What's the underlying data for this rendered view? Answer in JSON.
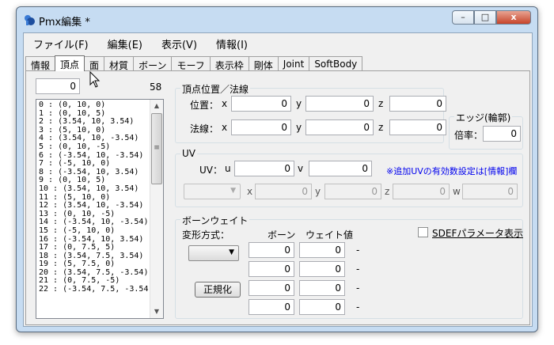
{
  "window": {
    "title": "Pmx編集 *",
    "controls": [
      "–",
      "□",
      "x"
    ]
  },
  "menu": [
    "ファイル(F)",
    "編集(E)",
    "表示(V)",
    "情報(I)"
  ],
  "tabs": [
    {
      "label": "情報",
      "active": false
    },
    {
      "label": "頂点",
      "active": true
    },
    {
      "label": "面",
      "active": false
    },
    {
      "label": "材質",
      "active": false
    },
    {
      "label": "ボーン",
      "active": false
    },
    {
      "label": "モーフ",
      "active": false
    },
    {
      "label": "表示枠",
      "active": false
    },
    {
      "label": "剛体",
      "active": false
    },
    {
      "label": "Joint",
      "active": false
    },
    {
      "label": "SoftBody",
      "active": false
    }
  ],
  "vertex_panel": {
    "index_value": "0",
    "count": "58",
    "items": [
      "0 : (0, 10, 0)",
      "1 : (0, 10, 5)",
      "2 : (3.54, 10, 3.54)",
      "3 : (5, 10, 0)",
      "4 : (3.54, 10, -3.54)",
      "5 : (0, 10, -5)",
      "6 : (-3.54, 10, -3.54)",
      "7 : (-5, 10, 0)",
      "8 : (-3.54, 10, 3.54)",
      "9 : (0, 10, 5)",
      "10 : (3.54, 10, 3.54)",
      "11 : (5, 10, 0)",
      "12 : (3.54, 10, -3.54)",
      "13 : (0, 10, -5)",
      "14 : (-3.54, 10, -3.54)",
      "15 : (-5, 10, 0)",
      "16 : (-3.54, 10, 3.54)",
      "17 : (0, 7.5, 5)",
      "18 : (3.54, 7.5, 3.54)",
      "19 : (5, 7.5, 0)",
      "20 : (3.54, 7.5, -3.54)",
      "21 : (0, 7.5, -5)",
      "22 : (-3.54, 7.5, -3.54)"
    ]
  },
  "position_group": {
    "title": "頂点位置／法線",
    "position_label": "位置：",
    "normal_label": "法線：",
    "axis_x": "x",
    "axis_y": "y",
    "axis_z": "z",
    "position": [
      "0",
      "0",
      "0"
    ],
    "normal": [
      "0",
      "0",
      "0"
    ]
  },
  "edge_group": {
    "title": "エッジ(輪郭)",
    "rate_label": "倍率：",
    "rate_value": "0"
  },
  "uv_group": {
    "title": "UV",
    "uv_label": "UV：",
    "axis_u": "u",
    "axis_v": "v",
    "u": "0",
    "v": "0",
    "note": "※追加UVの有効数設定は[情報]欄",
    "ext_x_label": "x",
    "ext_y_label": "y",
    "ext_z_label": "z",
    "ext_w_label": "w",
    "ext": [
      "0",
      "0",
      "0",
      "0"
    ]
  },
  "bone_weight_group": {
    "title": "ボーンウェイト",
    "deform_label": "変形方式：",
    "bone_header": "ボーン",
    "weight_header": "ウェイト値",
    "normalize_label": "正規化",
    "sdef_label": "SDEFパラメータ表示",
    "rows": [
      {
        "bone": "0",
        "weight": "0",
        "dash": "-"
      },
      {
        "bone": "0",
        "weight": "0",
        "dash": "-"
      },
      {
        "bone": "0",
        "weight": "0",
        "dash": "-"
      },
      {
        "bone": "0",
        "weight": "0",
        "dash": "-"
      }
    ]
  }
}
